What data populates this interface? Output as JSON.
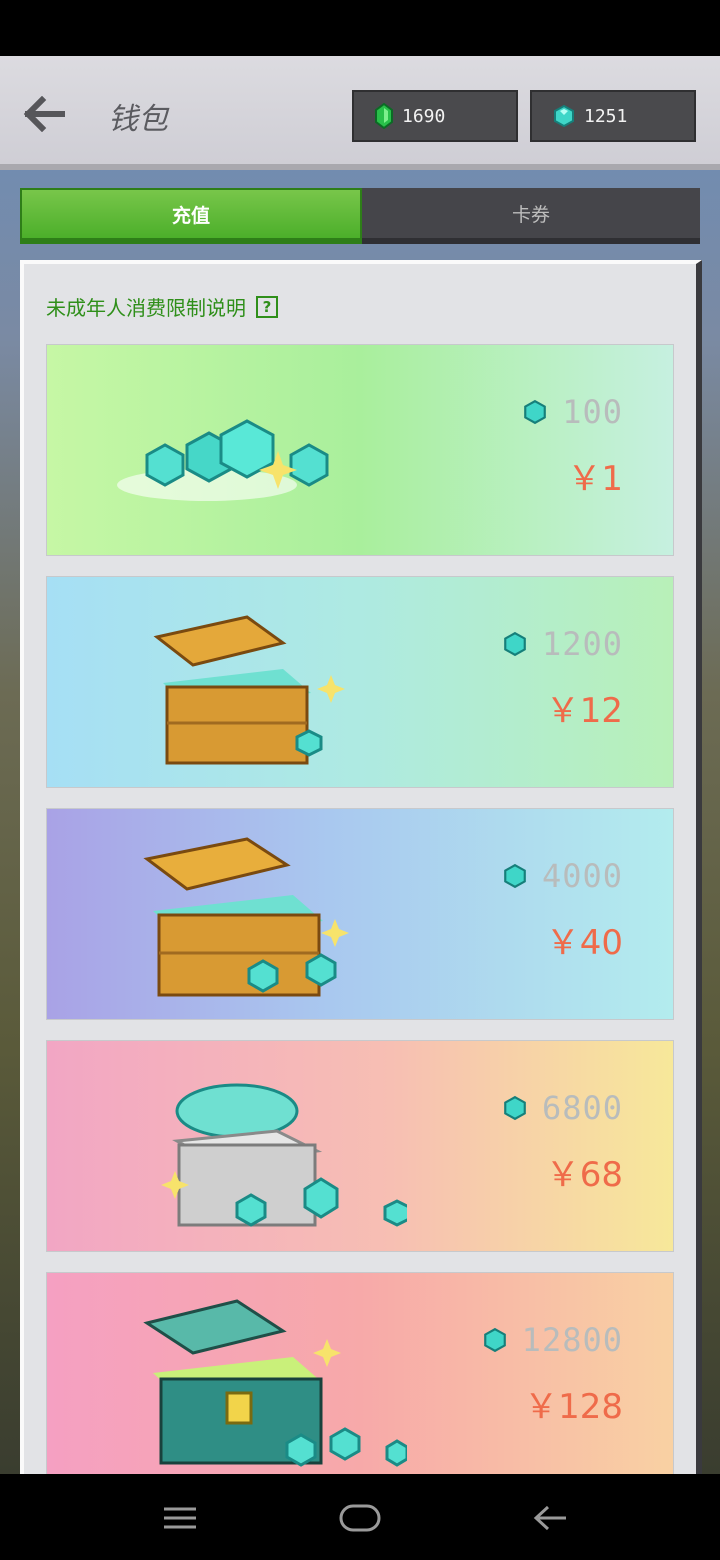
{
  "header": {
    "title": "钱包",
    "emerald_balance": "1690",
    "diamond_balance": "1251"
  },
  "tabs": [
    {
      "label": "充值",
      "active": true
    },
    {
      "label": "卡券",
      "active": false
    }
  ],
  "notice": {
    "text": "未成年人消费限制说明",
    "help_glyph": "?"
  },
  "packs": [
    {
      "amount": "100",
      "price": "￥1",
      "bg": "green"
    },
    {
      "amount": "1200",
      "price": "￥12",
      "bg": "cyan"
    },
    {
      "amount": "4000",
      "price": "￥40",
      "bg": "violet"
    },
    {
      "amount": "6800",
      "price": "￥68",
      "bg": "pink-yellow"
    },
    {
      "amount": "12800",
      "price": "￥128",
      "bg": "pink"
    }
  ],
  "colors": {
    "accent_green": "#4caf2a",
    "price_red": "#ef6b4a",
    "notice_green": "#2f8f1a"
  },
  "icons": [
    "back-arrow-icon",
    "emerald-icon",
    "diamond-icon",
    "help-icon",
    "menu-icon",
    "home-icon",
    "back-icon"
  ]
}
